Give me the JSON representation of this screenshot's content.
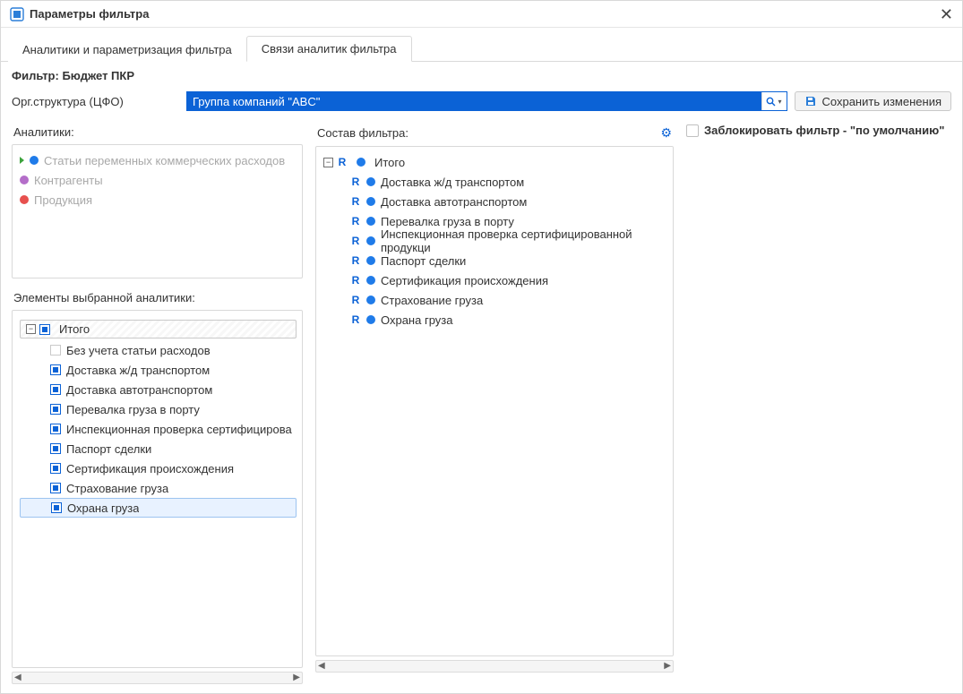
{
  "window": {
    "title": "Параметры фильтра"
  },
  "tabs": {
    "analytics": "Аналитики и параметризация фильтра",
    "links": "Связи аналитик фильтра"
  },
  "filterLabel": "Фильтр: Бюджет ПКР",
  "orgStruct": {
    "label": "Орг.структура (ЦФО)",
    "value": "Группа компаний \"ABC\""
  },
  "saveBtnLabel": "Сохранить изменения",
  "analyticsPanel": {
    "title": "Аналитики:",
    "items": [
      {
        "kind": "active",
        "color": "blue",
        "label": "Статьи переменных коммерческих расходов"
      },
      {
        "kind": "plain",
        "color": "purple",
        "label": "Контрагенты"
      },
      {
        "kind": "plain",
        "color": "red",
        "label": "Продукция"
      }
    ]
  },
  "elementsPanel": {
    "title": "Элементы выбранной аналитики:",
    "total": {
      "label": "Итого"
    },
    "items": [
      {
        "checked": false,
        "label": "Без учета статьи расходов"
      },
      {
        "checked": true,
        "label": "Доставка ж/д транспортом"
      },
      {
        "checked": true,
        "label": "Доставка автотранспортом"
      },
      {
        "checked": true,
        "label": "Перевалка груза в порту"
      },
      {
        "checked": true,
        "label": "Инспекционная проверка сертифицирова"
      },
      {
        "checked": true,
        "label": "Паспорт сделки"
      },
      {
        "checked": true,
        "label": "Сертификация происхождения"
      },
      {
        "checked": true,
        "label": "Страхование груза"
      },
      {
        "checked": true,
        "label": "Охрана груза",
        "selected": true
      }
    ]
  },
  "sostavPanel": {
    "title": "Состав фильтра:",
    "root": {
      "label": "Итого"
    },
    "items": [
      {
        "label": "Доставка ж/д транспортом"
      },
      {
        "label": "Доставка автотранспортом"
      },
      {
        "label": "Перевалка груза в порту"
      },
      {
        "label": "Инспекционная проверка сертифицированной продукци"
      },
      {
        "label": "Паспорт сделки"
      },
      {
        "label": "Сертификация происхождения"
      },
      {
        "label": "Страхование груза"
      },
      {
        "label": "Охрана груза"
      }
    ]
  },
  "lockFilter": {
    "label": "Заблокировать фильтр - \"по умолчанию\""
  }
}
